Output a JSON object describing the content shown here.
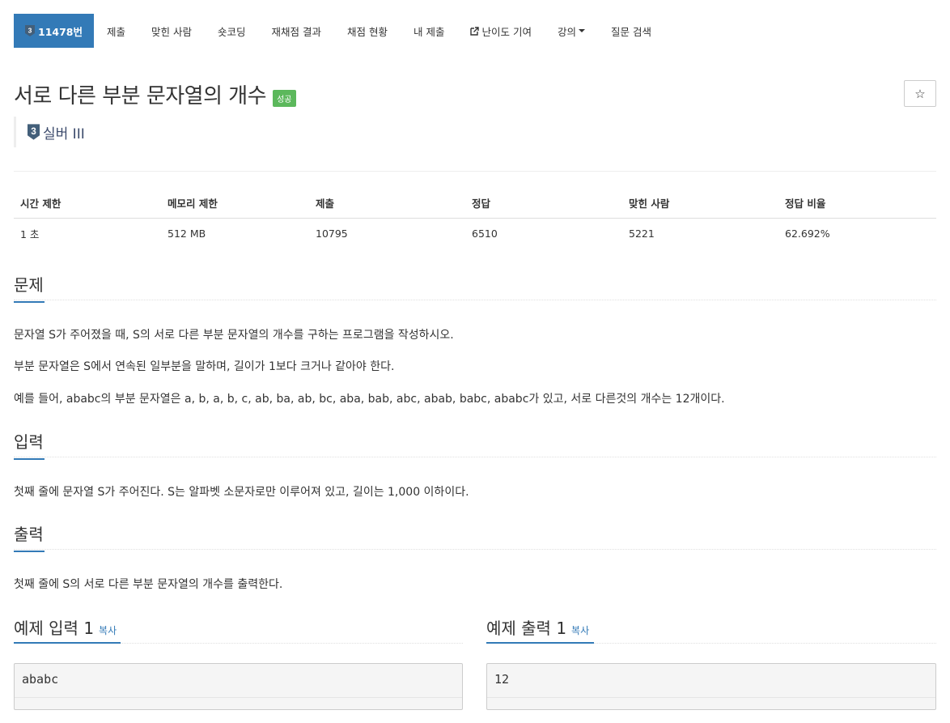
{
  "nav": {
    "problem_id": "11478번",
    "items": [
      "제출",
      "맞힌 사람",
      "숏코딩",
      "재채점 결과",
      "채점 현황",
      "내 제출",
      "난이도 기여",
      "강의",
      "질문 검색"
    ]
  },
  "problem": {
    "title": "서로 다른 부분 문자열의 개수",
    "status": "성공",
    "tier": "실버 III",
    "tier_number": "3"
  },
  "info": {
    "headers": [
      "시간 제한",
      "메모리 제한",
      "제출",
      "정답",
      "맞힌 사람",
      "정답 비율"
    ],
    "values": [
      "1 초",
      "512 MB",
      "10795",
      "6510",
      "5221",
      "62.692%"
    ]
  },
  "sections": {
    "problem_heading": "문제",
    "problem_text": [
      "문자열 S가 주어졌을 때, S의 서로 다른 부분 문자열의 개수를 구하는 프로그램을 작성하시오.",
      "부분 문자열은 S에서 연속된 일부분을 말하며, 길이가 1보다 크거나 같아야 한다.",
      "예를 들어, ababc의 부분 문자열은 a, b, a, b, c, ab, ba, ab, bc, aba, bab, abc, abab, babc, ababc가 있고, 서로 다른것의 개수는 12개이다."
    ],
    "input_heading": "입력",
    "input_text": "첫째 줄에 문자열 S가 주어진다. S는 알파벳 소문자로만 이루어져 있고, 길이는 1,000 이하이다.",
    "output_heading": "출력",
    "output_text": "첫째 줄에 S의 서로 다른 부분 문자열의 개수를 출력한다."
  },
  "examples": {
    "input_title": "예제 입력 1",
    "output_title": "예제 출력 1",
    "copy_label": "복사",
    "input_value": "ababc",
    "output_value": "12"
  },
  "colors": {
    "primary": "#337ab7",
    "success": "#5cb85c",
    "tier": "#3b4a6b"
  }
}
